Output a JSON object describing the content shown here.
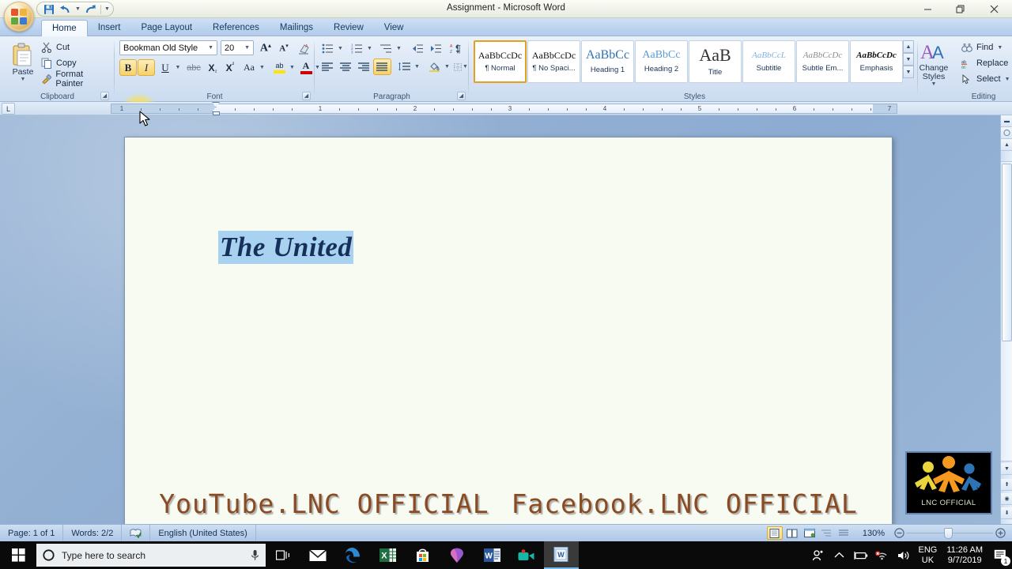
{
  "window": {
    "title": "Assignment - Microsoft Word",
    "minimize_label": "Minimize",
    "restore_label": "Restore Down",
    "close_label": "Close"
  },
  "quick_access": {
    "save_label": "Save",
    "undo_label": "Undo",
    "redo_label": "Redo",
    "customize_label": "Customize Quick Access Toolbar"
  },
  "ribbon": {
    "tabs": [
      {
        "label": "Home",
        "active": true
      },
      {
        "label": "Insert",
        "active": false
      },
      {
        "label": "Page Layout",
        "active": false
      },
      {
        "label": "References",
        "active": false
      },
      {
        "label": "Mailings",
        "active": false
      },
      {
        "label": "Review",
        "active": false
      },
      {
        "label": "View",
        "active": false
      }
    ],
    "clipboard": {
      "group_label": "Clipboard",
      "paste_label": "Paste",
      "cut_label": "Cut",
      "copy_label": "Copy",
      "format_painter_label": "Format Painter"
    },
    "font": {
      "group_label": "Font",
      "font_name": "Bookman Old Style",
      "font_size": "20",
      "grow_font_label": "Grow Font",
      "shrink_font_label": "Shrink Font",
      "clear_formatting_label": "Clear Formatting",
      "bold_label": "B",
      "italic_label": "I",
      "underline_label": "U",
      "strikethrough_label": "abc",
      "subscript_label": "X",
      "superscript_label": "X",
      "change_case_label": "Aa",
      "highlight_label": "ab",
      "font_color_label": "A"
    },
    "paragraph": {
      "group_label": "Paragraph",
      "bullets_label": "Bullets",
      "numbering_label": "Numbering",
      "multilevel_label": "Multilevel List",
      "decrease_indent_label": "Decrease Indent",
      "increase_indent_label": "Increase Indent",
      "sort_label": "Sort",
      "show_marks_label": "¶",
      "align_left_label": "Align Text Left",
      "align_center_label": "Center",
      "align_right_label": "Align Text Right",
      "justify_label": "Justify",
      "line_spacing_label": "Line Spacing",
      "shading_label": "Shading",
      "borders_label": "Borders",
      "active_alignment": "Justify"
    },
    "styles": {
      "group_label": "Styles",
      "items": [
        {
          "preview": "AaBbCcDc",
          "name": "¶ Normal",
          "selected": true
        },
        {
          "preview": "AaBbCcDc",
          "name": "¶ No Spaci...",
          "selected": false
        },
        {
          "preview": "AaBbCc",
          "name": "Heading 1",
          "selected": false
        },
        {
          "preview": "AaBbCc",
          "name": "Heading 2",
          "selected": false
        },
        {
          "preview": "AaB",
          "name": "Title",
          "selected": false
        },
        {
          "preview": "AaBbCcL",
          "name": "Subtitle",
          "selected": false
        },
        {
          "preview": "AaBbCcDc",
          "name": "Subtle Em...",
          "selected": false
        },
        {
          "preview": "AaBbCcDc",
          "name": "Emphasis",
          "selected": false
        }
      ],
      "change_styles_label": "Change Styles",
      "scroll_up_label": "Scroll Up",
      "scroll_down_label": "Scroll Down",
      "more_label": "More"
    },
    "editing": {
      "group_label": "Editing",
      "find_label": "Find",
      "replace_label": "Replace",
      "select_label": "Select"
    }
  },
  "ruler": {
    "tab_selector": "L",
    "marks": [
      "1",
      "1",
      "2",
      "3",
      "4",
      "5",
      "6",
      "7"
    ]
  },
  "document": {
    "body_text": "The United",
    "watermark_left": "YouTube.LNC OFFICIAL",
    "watermark_right": "Facebook.LNC OFFICIAL"
  },
  "logo": {
    "caption": "LNC OFFICIAL",
    "colors": {
      "left": "#e8d63c",
      "center": "#f59a1e",
      "right": "#2e74b5"
    }
  },
  "status_bar": {
    "page": "Page: 1 of 1",
    "words": "Words: 2/2",
    "language": "English (United States)",
    "proofing_label": "Proofing errors",
    "zoom": "130%",
    "zoom_out_label": "Zoom Out",
    "zoom_in_label": "Zoom In",
    "views": [
      {
        "name": "print-layout",
        "active": true
      },
      {
        "name": "full-screen-reading",
        "active": false
      },
      {
        "name": "web-layout",
        "active": false
      },
      {
        "name": "outline",
        "active": false
      },
      {
        "name": "draft",
        "active": false
      }
    ]
  },
  "taskbar": {
    "start_label": "Start",
    "search_placeholder": "Type here to search",
    "cortana_label": "Cortana",
    "microphone_label": "Microphone",
    "task_view_label": "Task View",
    "apps": [
      {
        "name": "mail",
        "label": "Mail"
      },
      {
        "name": "edge",
        "label": "Microsoft Edge"
      },
      {
        "name": "excel",
        "label": "Excel"
      },
      {
        "name": "store",
        "label": "Microsoft Store"
      },
      {
        "name": "maps",
        "label": "Maps"
      },
      {
        "name": "word",
        "label": "Word"
      },
      {
        "name": "camtasia-recorder",
        "label": "Camtasia Recorder"
      },
      {
        "name": "word-document",
        "label": "Assignment - Microsoft Word"
      }
    ],
    "tray": {
      "people_label": "People",
      "show_hidden_label": "Show hidden icons",
      "battery_label": "Battery",
      "network_label": "Network - not connected",
      "volume_label": "Volume",
      "language": "ENG",
      "region": "UK",
      "time": "11:26 AM",
      "date": "9/7/2019",
      "notifications_count": "1"
    }
  }
}
